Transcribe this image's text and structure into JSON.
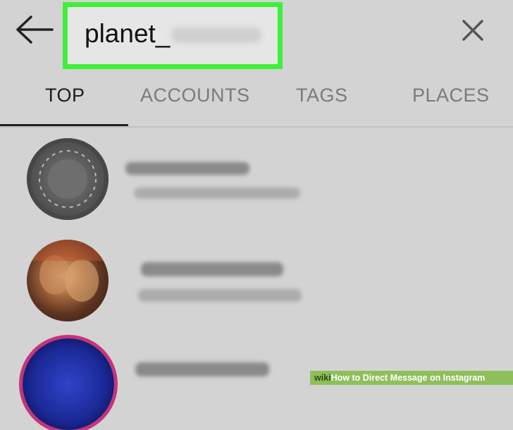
{
  "search": {
    "query_visible": "planet_",
    "border_color": "#3ff03b"
  },
  "icons": {
    "back": "arrow-left-icon",
    "clear": "close-icon"
  },
  "tabs": [
    {
      "label": "TOP",
      "active": true
    },
    {
      "label": "ACCOUNTS",
      "active": false
    },
    {
      "label": "TAGS",
      "active": false
    },
    {
      "label": "PLACES",
      "active": false
    }
  ],
  "watermark": {
    "brand": "wiki",
    "title": "How to Direct Message on Instagram"
  }
}
